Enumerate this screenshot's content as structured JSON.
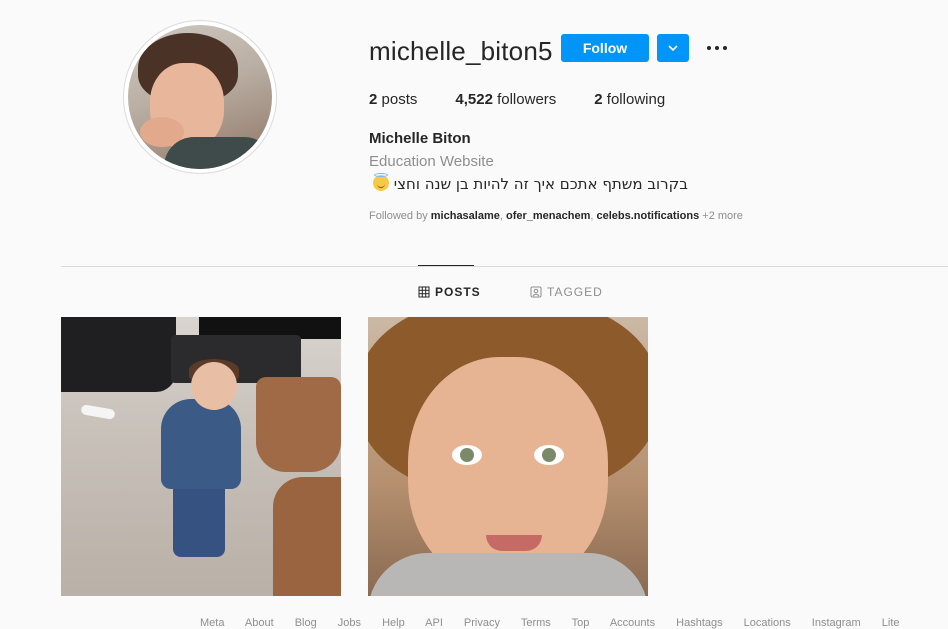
{
  "profile": {
    "username": "michelle_biton5",
    "follow_label": "Follow",
    "stats": {
      "posts_count": "2",
      "posts_label": "posts",
      "followers_count": "4,522",
      "followers_label": "followers",
      "following_count": "2",
      "following_label": "following"
    },
    "full_name": "Michelle Biton",
    "category": "Education Website",
    "bio": "בקרוב משתף אתכם איך זה להיות בן שנה וחצי",
    "bio_emoji": "smiling-face-with-halo",
    "followed_by": {
      "prefix": "Followed by",
      "users": [
        "michasalame",
        "ofer_menachem",
        "celebs.notifications"
      ],
      "more": "+2 more"
    }
  },
  "tabs": [
    {
      "label": "POSTS",
      "icon": "grid-icon",
      "active": true
    },
    {
      "label": "TAGGED",
      "icon": "tagged-icon",
      "active": false
    }
  ],
  "posts": [
    {
      "description": "toddler in blue tracksuit walking in living room"
    },
    {
      "description": "close-up of curly-haired toddler smiling"
    }
  ],
  "colors": {
    "accent": "#0095f6",
    "text": "#262626",
    "muted": "#8e8e8e",
    "background": "#fafafa"
  },
  "footer": {
    "text": "Meta About Blog Jobs Help API Privacy Terms Top Accounts Hashtags Locations Instagram Lite"
  }
}
